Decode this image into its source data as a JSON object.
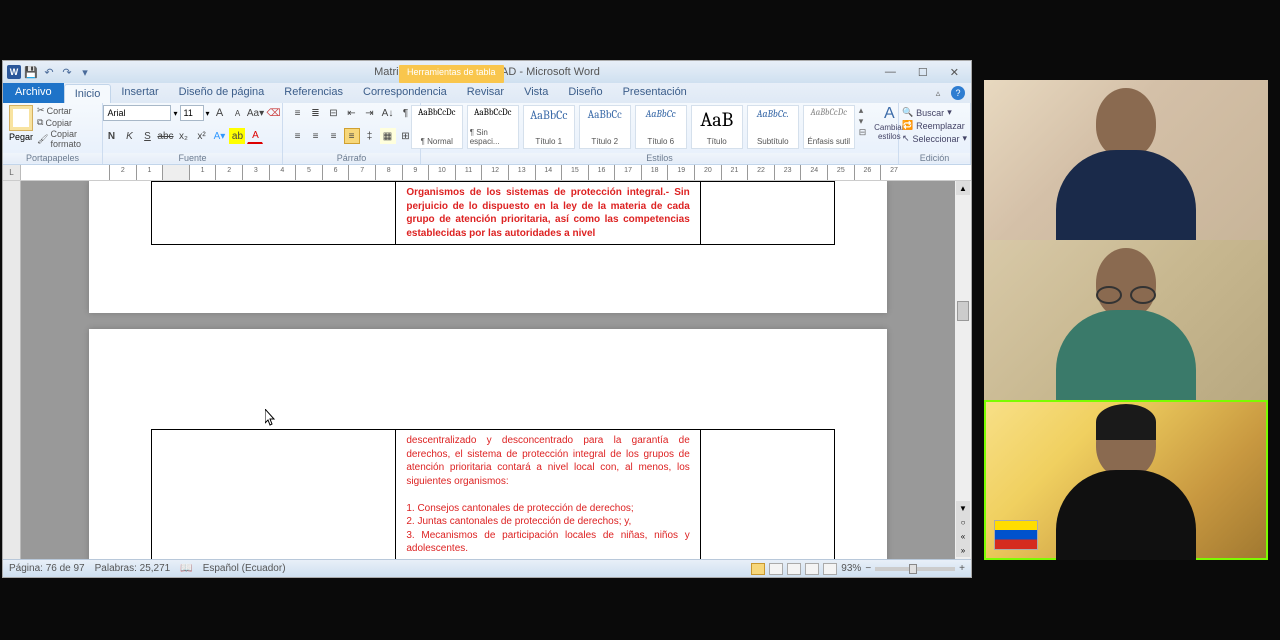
{
  "word": {
    "title": "Matriz comparativa COOTAD - Microsoft Word",
    "qat": {
      "word_icon": "W"
    },
    "context_tab": "Herramientas de tabla",
    "tabs": {
      "file": "Archivo",
      "home": "Inicio",
      "insert": "Insertar",
      "layout": "Diseño de página",
      "references": "Referencias",
      "mailings": "Correspondencia",
      "review": "Revisar",
      "view": "Vista",
      "design": "Diseño",
      "presentation": "Presentación"
    },
    "ribbon": {
      "clipboard": {
        "paste": "Pegar",
        "cut": "Cortar",
        "copy": "Copiar",
        "format": "Copiar formato",
        "label": "Portapapeles"
      },
      "font": {
        "name": "Arial",
        "size": "11",
        "label": "Fuente"
      },
      "paragraph": {
        "label": "Párrafo"
      },
      "styles": {
        "s1": {
          "preview": "AaBbCcDc",
          "name": "¶ Normal"
        },
        "s2": {
          "preview": "AaBbCcDc",
          "name": "¶ Sin espaci..."
        },
        "s3": {
          "preview": "AaBbCc",
          "name": "Título 1"
        },
        "s4": {
          "preview": "AaBbCc",
          "name": "Título 2"
        },
        "s5": {
          "preview": "AaBbCc",
          "name": "Título 6"
        },
        "s6": {
          "preview": "AaB",
          "name": "Título"
        },
        "s7": {
          "preview": "AaBbCc.",
          "name": "Subtítulo"
        },
        "s8": {
          "preview": "AaBbCcDc",
          "name": "Énfasis sutil"
        },
        "changer": "Cambiar estilos",
        "label": "Estilos"
      },
      "editing": {
        "find": "Buscar",
        "replace": "Reemplazar",
        "select": "Seleccionar",
        "label": "Edición"
      }
    },
    "document": {
      "page1_text": "Organismos de los sistemas de protección integral.- Sin perjuicio de lo dispuesto en la ley de la materia de cada grupo de atención prioritaria, así como las competencias establecidas por las autoridades a nivel",
      "page2_text": "descentralizado y desconcentrado para la garantía de derechos, el sistema de protección integral de los grupos de atención prioritaria contará a nivel local con, al menos, los siguientes organismos:",
      "list1": "1.        Consejos cantonales de protección de derechos;",
      "list2": "2.        Juntas cantonales de protección de derechos; y,",
      "list3": "3.        Mecanismos de participación locales de niñas, niños y adolescentes."
    },
    "status": {
      "page": "Página: 76 de 97",
      "words": "Palabras: 25,271",
      "lang": "Español (Ecuador)",
      "zoom": "93%"
    }
  }
}
